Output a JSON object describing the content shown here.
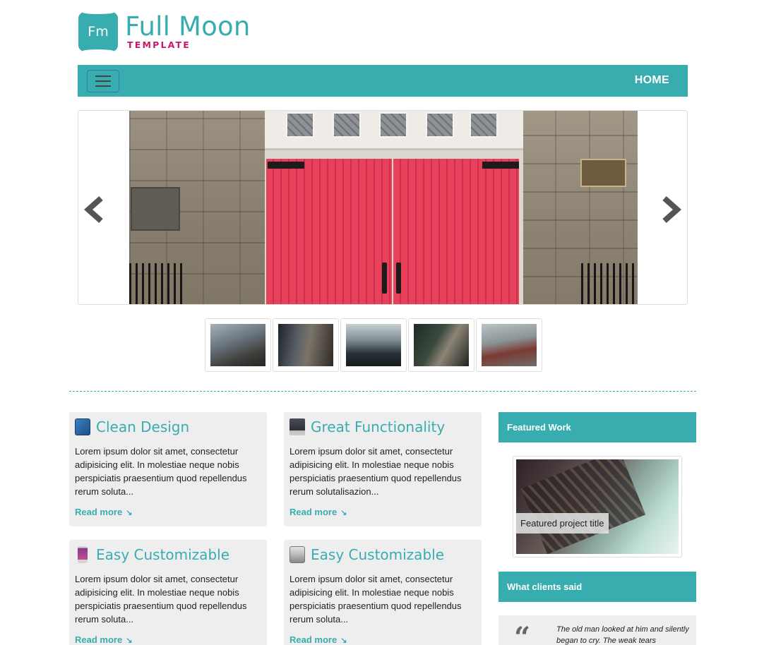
{
  "logo": {
    "badge": "Fm",
    "title": "Full Moon",
    "subtitle": "TEMPLATE"
  },
  "nav": {
    "menu_icon": "hamburger-icon",
    "home_label": "HOME"
  },
  "slider": {
    "prev_icon": "chevron-left-icon",
    "next_icon": "chevron-right-icon",
    "thumbnails": [
      "thumbnail-1",
      "thumbnail-2",
      "thumbnail-3",
      "thumbnail-4",
      "thumbnail-5"
    ]
  },
  "features": [
    {
      "title": "Clean Design",
      "icon": "address-book-icon",
      "body": "Lorem ipsum dolor sit amet, consectetur adipisicing elit. In molestiae neque nobis perspiciatis praesentium quod repellendus rerum soluta...",
      "link": "Read more"
    },
    {
      "title": "Great Functionality",
      "icon": "monitor-icon",
      "body": "Lorem ipsum dolor sit amet, consectetur adipisicing elit. In molestiae neque nobis perspiciatis praesentium quod repellendus rerum solutalisazion...",
      "link": "Read more"
    },
    {
      "title": "Easy Customizable",
      "icon": "phone-icon",
      "body": "Lorem ipsum dolor sit amet, consectetur adipisicing elit. In molestiae neque nobis perspiciatis praesentium quod repellendus rerum soluta...",
      "link": "Read more"
    },
    {
      "title": "Easy Customizable",
      "icon": "hard-drive-icon",
      "body": "Lorem ipsum dolor sit amet, consectetur adipisicing elit. In molestiae neque nobis perspiciatis praesentium quod repellendus rerum soluta...",
      "link": "Read more"
    }
  ],
  "sidebar": {
    "featured_heading": "Featured Work",
    "featured_caption": "Featured project title",
    "clients_heading": "What clients said",
    "quote_icon": "quote-icon",
    "quote_text": "The old man looked at him and silently began to cry. The weak tears"
  },
  "colors": {
    "accent": "#38adb0",
    "brand_pink": "#c8186c",
    "card_bg": "#eeeeee"
  }
}
